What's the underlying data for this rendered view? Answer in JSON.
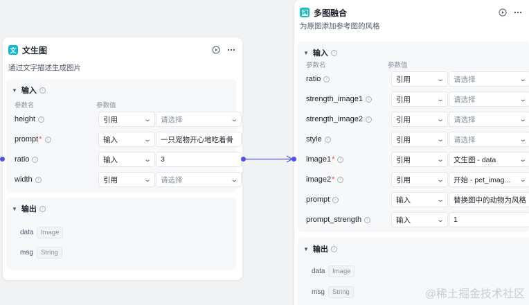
{
  "colors": {
    "accent": "#4d53e8",
    "left_icon": "#0fb9d4",
    "right_icon": "#13c2c2"
  },
  "left": {
    "icon_char": "文",
    "title": "文生图",
    "desc": "通过文字描述生成图片",
    "input_title": "输入",
    "col_name": "参数名",
    "col_value": "参数值",
    "rows": [
      {
        "name": "height",
        "required": false,
        "mode": "引用",
        "value": "请选择",
        "placeholder": true
      },
      {
        "name": "prompt",
        "required": true,
        "mode": "输入",
        "value": "一只宠物开心地吃着骨",
        "placeholder": false
      },
      {
        "name": "ratio",
        "required": false,
        "mode": "输入",
        "value": "3",
        "placeholder": false
      },
      {
        "name": "width",
        "required": false,
        "mode": "引用",
        "value": "请选择",
        "placeholder": true
      }
    ],
    "output_title": "输出",
    "outputs": [
      {
        "name": "data",
        "type": "Image"
      },
      {
        "name": "msg",
        "type": "String"
      }
    ]
  },
  "right": {
    "title": "多图融合",
    "desc": "为原图添加参考图的风格",
    "input_title": "输入",
    "col_name": "参数名",
    "col_value": "参数值",
    "rows": [
      {
        "name": "ratio",
        "required": false,
        "mode": "引用",
        "value": "请选择",
        "placeholder": true
      },
      {
        "name": "strength_image1",
        "required": false,
        "mode": "引用",
        "value": "请选择",
        "placeholder": true
      },
      {
        "name": "strength_image2",
        "required": false,
        "mode": "引用",
        "value": "请选择",
        "placeholder": true
      },
      {
        "name": "style",
        "required": false,
        "mode": "引用",
        "value": "请选择",
        "placeholder": true
      },
      {
        "name": "image1",
        "required": true,
        "mode": "引用",
        "value": "文生图 - data",
        "placeholder": false
      },
      {
        "name": "image2",
        "required": true,
        "mode": "引用",
        "value": "开始 - pet_imag...",
        "placeholder": false
      },
      {
        "name": "prompt",
        "required": false,
        "mode": "输入",
        "value": "替换图中的动物为风格",
        "placeholder": false
      },
      {
        "name": "prompt_strength",
        "required": false,
        "mode": "输入",
        "value": "1",
        "placeholder": false
      }
    ],
    "output_title": "输出",
    "outputs": [
      {
        "name": "data",
        "type": "Image"
      },
      {
        "name": "msg",
        "type": "String"
      }
    ]
  },
  "watermark": "@稀土掘金技术社区"
}
